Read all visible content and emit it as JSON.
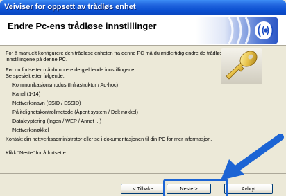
{
  "window": {
    "title": "Veiviser for oppsett av trådløs enhet"
  },
  "header": {
    "title": "Endre Pc-ens trådløse innstillinger"
  },
  "content": {
    "intro_line1": "For å manuelt konfigurere den trådløse enheten fra denne PC må du midlertidig endre de trådløse",
    "intro_line2": "innstillingene på denne PC.",
    "note_line1": "Før du fortsetter må du notere de gjeldende innstillingene.",
    "note_line2": "Se spesielt etter følgende:",
    "settings": [
      "Kommunikasjonsmodus (Infrastruktur / Ad-hoc)",
      "Kanal (1-14)",
      "Nettverksnavn (SSID / ESSID)",
      "Pålitelighetskontrollmetode (Åpent system / Delt nøkkel)",
      "Datakryptering (Ingen / WEP / Annet ...)",
      "Nettverksnøkkel"
    ],
    "contact_text": "Kontakt din nettverksadministrator eller se i dokumentasjonen til din PC for mer informasjon.",
    "next_hint": "Klikk \"Neste\" for å fortsette."
  },
  "buttons": {
    "back": "< Tilbake",
    "next": "Neste >",
    "cancel": "Avbryt"
  },
  "colors": {
    "title_bar": "#0b4fd0",
    "highlight": "#1c64d4",
    "background": "#ece9d8"
  }
}
